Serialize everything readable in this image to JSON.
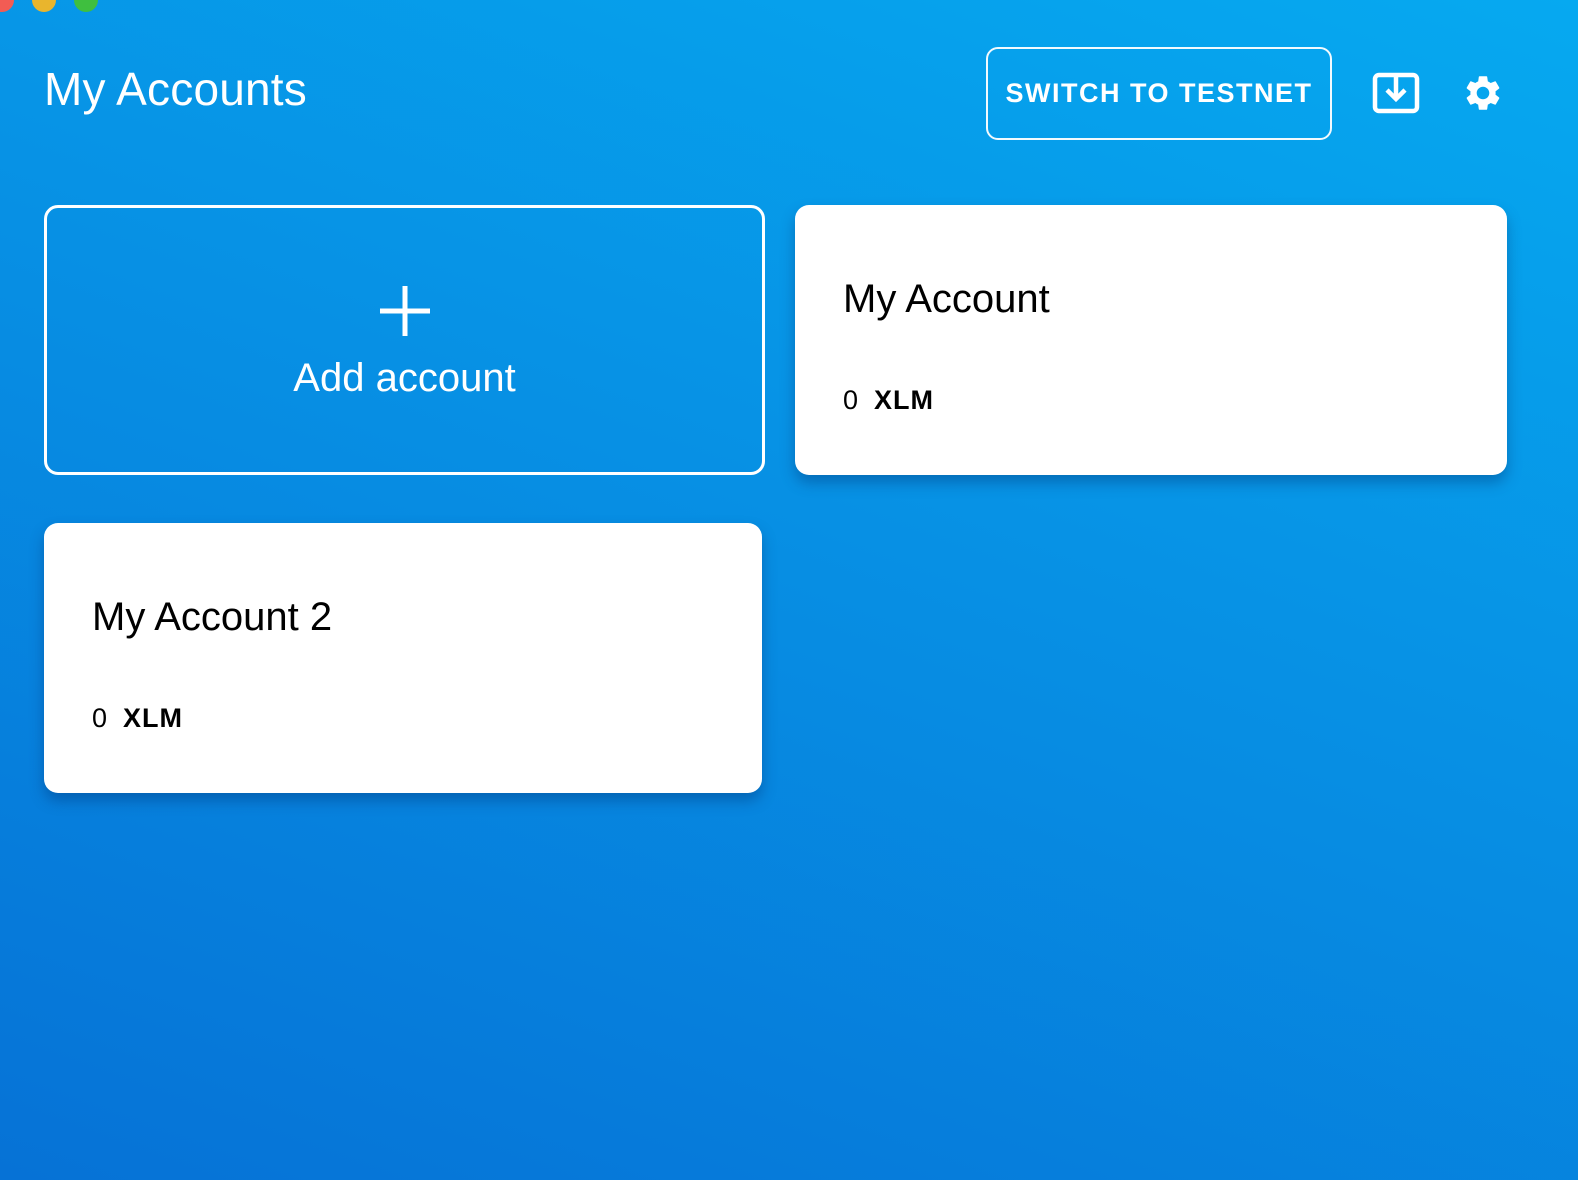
{
  "window": {
    "controls": [
      "close",
      "minimize",
      "zoom"
    ]
  },
  "header": {
    "title": "My Accounts",
    "network_button_label": "SWITCH TO TESTNET",
    "export_icon": "download-icon",
    "settings_icon": "gear-icon"
  },
  "add_account": {
    "icon": "plus-icon",
    "label": "Add account"
  },
  "accounts": [
    {
      "name": "My Account",
      "balance": "0",
      "asset": "XLM"
    },
    {
      "name": "My Account 2",
      "balance": "0",
      "asset": "XLM"
    }
  ],
  "colors": {
    "background_top": "#06a9f0",
    "background_bottom": "#0672d6",
    "card_background": "#ffffff",
    "text_on_background": "#ffffff",
    "text_on_card": "#000000"
  }
}
